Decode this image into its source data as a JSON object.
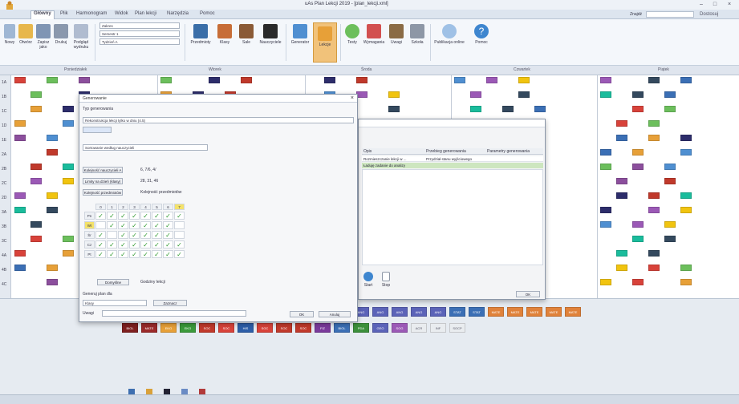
{
  "app": {
    "title": "uAs Plan Lekcji 2019 - [plan_lekcji.xml]"
  },
  "menu": {
    "tabs": [
      "Główny",
      "Plik",
      "Harmonogram",
      "Widok",
      "Plan lekcji",
      "Narzędzia",
      "Pomoc"
    ],
    "active_index": 0,
    "search_label": "Znajdź",
    "customize_label": "Dostosuj"
  },
  "ribbon": {
    "buttons": [
      {
        "label": "Nowy",
        "icon": "new-icon",
        "color": "#9fb7d4"
      },
      {
        "label": "Otwórz",
        "icon": "open-folder-icon",
        "color": "#e7b74c"
      },
      {
        "label": "Zapisz jako",
        "icon": "save-icon",
        "color": "#7f95b4"
      },
      {
        "label": "Drukuj",
        "icon": "print-icon",
        "color": "#8a98ad"
      },
      {
        "label": "Podgląd wydruku",
        "icon": "preview-icon",
        "color": "#b0bcd0"
      },
      {
        "label": "Przedmioty",
        "icon": "subjects-icon",
        "color": "#3a6ea8"
      },
      {
        "label": "Klasy",
        "icon": "classes-icon",
        "color": "#c76d37"
      },
      {
        "label": "Sale",
        "icon": "rooms-icon",
        "color": "#8a5a36"
      },
      {
        "label": "Nauczyciele",
        "icon": "teachers-icon",
        "color": "#2a2a2a"
      },
      {
        "label": "Generator",
        "icon": "generator-icon",
        "color": "#4f8fd1"
      },
      {
        "label": "Lekcje",
        "icon": "lessons-icon",
        "color": "#e7a038"
      },
      {
        "label": "Testy",
        "icon": "check-icon",
        "color": "#6cbf5c"
      },
      {
        "label": "Wymagania",
        "icon": "requirements-icon",
        "color": "#d25050"
      },
      {
        "label": "Uwagi",
        "icon": "gavel-icon",
        "color": "#8a6b45"
      },
      {
        "label": "Szkoła",
        "icon": "building-icon",
        "color": "#8d97a6"
      },
      {
        "label": "Publikacja online",
        "icon": "cloud-icon",
        "color": "#9fc1e6"
      },
      {
        "label": "Pomoc",
        "icon": "help-icon",
        "color": "#3e86cf"
      }
    ],
    "lists": [
      "Zakres",
      "Semestr 1",
      "Tydzień A"
    ]
  },
  "grid": {
    "day_headers": [
      "Poniedziałek",
      "Wtorek",
      "Środa",
      "Czwartek",
      "Piątek"
    ],
    "row_labels": [
      "1A",
      "1B",
      "1C",
      "1D",
      "1E",
      "2A",
      "2B",
      "2C",
      "2D",
      "3A",
      "3B",
      "3C",
      "4A",
      "4B",
      "4C"
    ]
  },
  "dialog_main": {
    "title": "Generowanie",
    "section1": "Typ generowania",
    "select1": "Rekonstrukcja lekcji tylko w dniu (4.5)",
    "select2": "Sortowanie według nauczycieli",
    "btn_a": "Kolejność nauczycieli A",
    "val_a": "6, 7/6, 4/",
    "btn_b": "Limity na dzień (klasy)",
    "val_b": "28, 31, 46",
    "btn_c": "Kolejność przedmiotów",
    "val_c": "Kolejność przedmiotów",
    "col_headers": [
      "0",
      "1",
      "2",
      "3",
      "4",
      "5",
      "6",
      "7"
    ],
    "row_headers": [
      "Pn",
      "Wt",
      "Śr",
      "Cz",
      "Pt"
    ],
    "btn_default": "Domyślne",
    "default_note": "Godziny lekcji",
    "section2": "Generuj plan dla",
    "select3": "Klasy",
    "btn_select": "Zaznacz",
    "note_label": "Uwagi",
    "ok": "OK",
    "cancel": "Anuluj"
  },
  "dialog_list": {
    "col1": "Opis",
    "col2": "Przebieg generowania",
    "col3": "Parametry generowania",
    "rows": [
      [
        "Rozmieszczanie lekcji w ...",
        "Przydział stanu wyjściowego",
        ""
      ],
      [
        "Ładuję zadanie do analizy",
        "",
        ""
      ]
    ],
    "btn_start": "Start",
    "btn_stop": "Stop",
    "btn_close": "OK"
  },
  "bottom_tiles": [
    "ANG",
    "ANG",
    "ANG",
    "ANG",
    "ANG",
    "STAT",
    "STAT",
    "MATE",
    "MATE",
    "MATE",
    "MATE",
    "MATE",
    "BIOL",
    "MATE",
    "EKO",
    "EKO",
    "SOC",
    "SOC",
    "HIS",
    "SOC",
    "SOC",
    "SOC",
    "FIZ",
    "BIOL",
    "PDA",
    "GEO",
    "SOG",
    "ACR",
    "INF",
    "SOCP"
  ],
  "bottom_icons": [
    "arrow-icon",
    "person-icon",
    "chess-icon",
    "window-icon",
    "bars-icon"
  ],
  "colors": {
    "ribbon_bg": "#f4f7fb",
    "accent_blue": "#2f5ea3",
    "grid_bg": "#ffffff"
  }
}
